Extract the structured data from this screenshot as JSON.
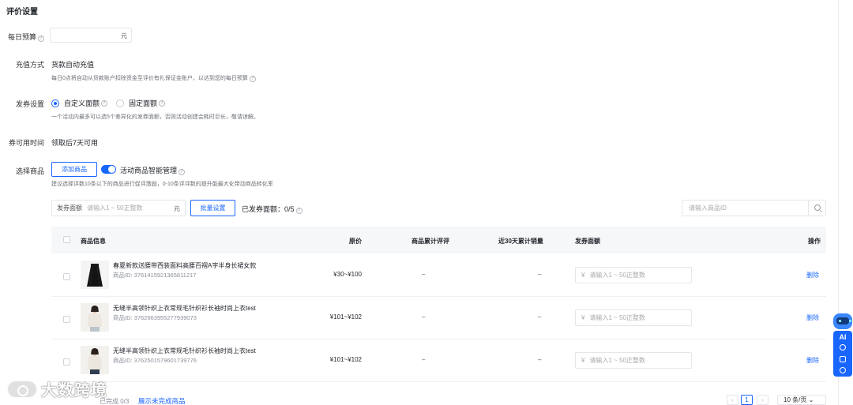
{
  "page": {
    "title": "评价设置"
  },
  "budget": {
    "label": "每日预算",
    "unit": "元",
    "value": ""
  },
  "recharge": {
    "label": "充值方式",
    "value": "货款自动充值",
    "hint": "每日0点将自动从货款账户扣除资金至评价有礼保证金账户，以达到您的每日预算"
  },
  "coupon_type": {
    "label": "发券设置",
    "options": [
      "自定义面额",
      "固定面额"
    ],
    "selected": "自定义面额",
    "hint": "一个活动内最多可以选5个差异化的发券面额，否则活动创建会耗时巨长，敬请谅解。"
  },
  "availability": {
    "label": "券可用时间",
    "value": "领取后7天可用"
  },
  "select_goods": {
    "label": "选择商品",
    "add_button": "添加商品",
    "smart_toggle_label": "活动商品智能管理",
    "smart_toggle_on": true,
    "hint": "建议选择评数10条以下的商品进行促评激励，0-10条评评数的提升能最大化带动商品转化率"
  },
  "toolbar": {
    "face_label": "发券面额",
    "face_placeholder": "请输入1 ~ 50正整数",
    "face_unit": "元",
    "bulk_button": "批量设置",
    "issued_label": "已发券面额：0/5",
    "search_placeholder": "请输入商品ID"
  },
  "table": {
    "columns": [
      "商品信息",
      "原价",
      "商品累计评评",
      "近30天累计销量",
      "发券面额",
      "操作"
    ],
    "rows": [
      {
        "name": "春夏新款送腰带西装面料高腰百褶A字半身长裙女款",
        "id_text": "商品ID: 3761415921365811217",
        "price": "¥30~¥100",
        "reviews": "–",
        "sales": "–",
        "currency": "¥",
        "input_placeholder": "请输入1 ~ 50正整数",
        "action": "删除",
        "thumb": "skirt"
      },
      {
        "name": "无缝半高领针织上衣常规毛针织衫长袖时尚上衣test",
        "id_text": "商品ID: 3762663955277939073",
        "price": "¥101~¥102",
        "reviews": "–",
        "sales": "–",
        "currency": "¥",
        "input_placeholder": "请输入1 ~ 50正整数",
        "action": "删除",
        "thumb": "sweater"
      },
      {
        "name": "无缝半高领针织上衣常规毛针织衫长袖时尚上衣test",
        "id_text": "商品ID: 3762501579601739776",
        "price": "¥101~¥102",
        "reviews": "–",
        "sales": "–",
        "currency": "¥",
        "input_placeholder": "请输入1 ~ 50正整数",
        "action": "删除",
        "thumb": "sweater"
      }
    ]
  },
  "footer": {
    "done_text": "已完成 0/3",
    "show_incomplete_link": "展示未完成商品",
    "prev": "‹",
    "next": "›",
    "current_page": "1",
    "page_size": "10 条/页"
  },
  "side_widget": {
    "ai_label": "AI"
  },
  "watermark": {
    "text": "大数跨境"
  },
  "colors": {
    "accent": "#1966ff",
    "table_header_bg": "#f6f7f9"
  }
}
